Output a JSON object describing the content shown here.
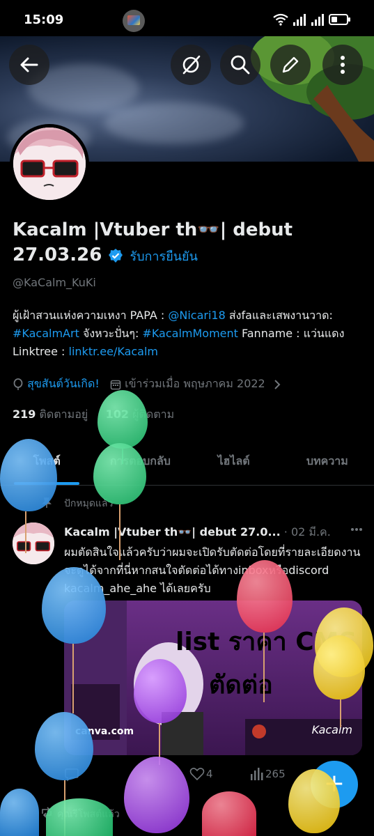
{
  "status_bar": {
    "time": "15:09"
  },
  "profile": {
    "name_line": "Kacalm |Vtuber th👓| debut 27.03.26",
    "verified_label": "รับการยืนยัน",
    "handle": "@KaCalm_KuKi",
    "bio_1": "ผู้เฝ้าสวนแห่งความเหงา PAPA : ",
    "bio_link_1": "@Nicari18",
    "bio_2": " ส่งfaและเสพงานวาด: ",
    "bio_link_2": "#KacalmArt",
    "bio_3": "  จังหวะปั่นๆ: ",
    "bio_link_3": "#KacalmMoment",
    "bio_4": " Fanname : แว่นแดง Linktree : ",
    "bio_link_4": "linktr.ee/Kacalm",
    "birthday": "สุขสันต์วันเกิด!",
    "joined": "เข้าร่วมเมื่อ พฤษภาคม 2022",
    "following_count": "219",
    "following_label": "ติดตามอยู่",
    "followers_count": "102",
    "followers_label": "ผู้ติดตาม"
  },
  "tabs": [
    {
      "label": "โพสต์"
    },
    {
      "label": "การตอบกลับ"
    },
    {
      "label": "ไฮไลต์"
    },
    {
      "label": "บทความ"
    }
  ],
  "pinned_label": "ปักหมุดแล้ว",
  "post": {
    "author": "Kacalm |Vtuber th👓| debut 27.0...",
    "date": " · 02 มี.ค.",
    "text": "ผมตัดสินใจแล้วครับว่าผมจะเปิดรับตัดต่อโดยที่รายละเอียดงานจะดูได้จากที่นี่หากสนใจตัดต่อได้ทางinboxหรือdiscord kacalm_ahe_ahe ได้เลยครับ",
    "media_title_1": "list ราคา CMS",
    "media_title_2": "ตัดต่อ",
    "media_source": "canva.com",
    "media_signature": "Kacalm",
    "likes": "4",
    "views": "265"
  },
  "repost_note": "คุณรีโพสต์แล้ว",
  "fab_label": "+",
  "colors": {
    "accent": "#1d9bf0",
    "background": "#000000"
  }
}
